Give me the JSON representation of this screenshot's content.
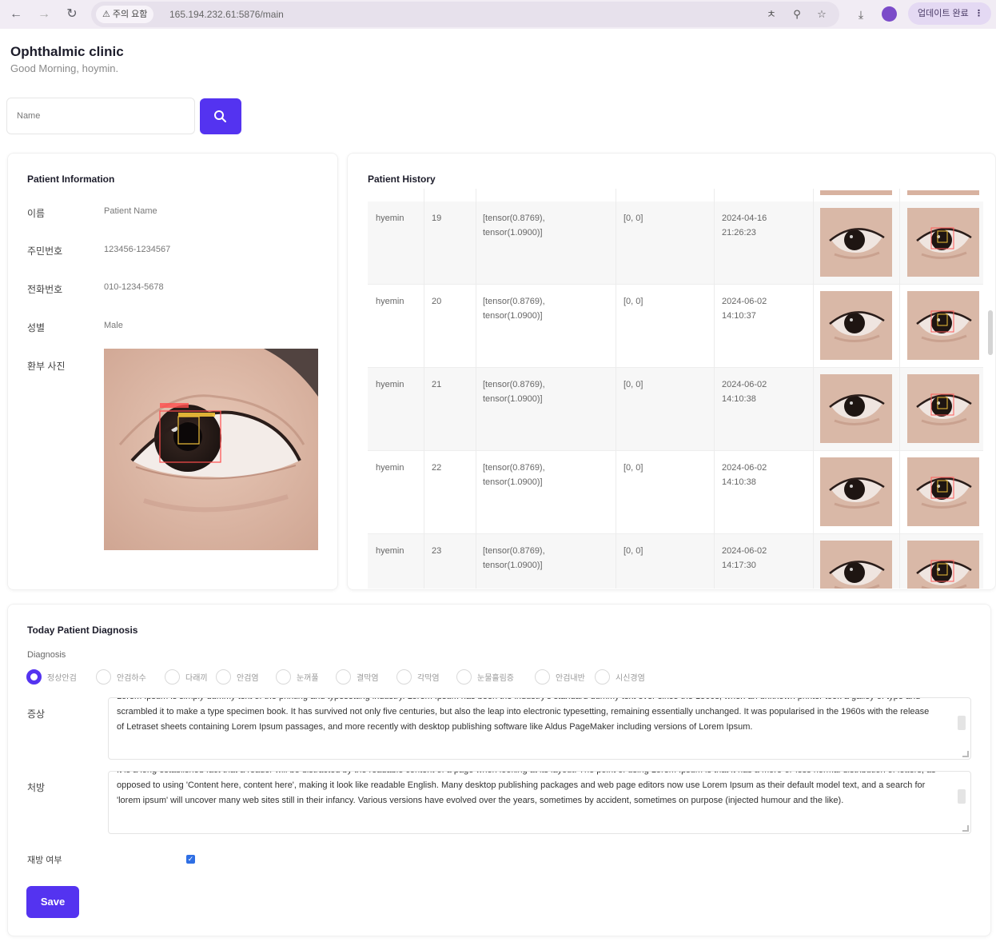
{
  "browser": {
    "security_label": "주의 요함",
    "url": "165.194.232.61:5876/main",
    "update_label": "업데이트 완료"
  },
  "header": {
    "title": "Ophthalmic clinic",
    "greeting": "Good Morning, hoymin."
  },
  "search": {
    "placeholder": "Name"
  },
  "patient_info": {
    "title": "Patient Information",
    "fields": [
      {
        "label": "이름",
        "value": "Patient Name"
      },
      {
        "label": "주민번호",
        "value": "123456-1234567"
      },
      {
        "label": "전화번호",
        "value": "010-1234-5678"
      },
      {
        "label": "성별",
        "value": "Male"
      },
      {
        "label": "환부 사진",
        "value": ""
      }
    ]
  },
  "history": {
    "title": "Patient History",
    "rows": [
      {
        "name": "hyemin",
        "id": "19",
        "tensor_line1": "[tensor(0.8769),",
        "tensor_line2": "tensor(1.0900)]",
        "pair": "[0, 0]",
        "date": "2024-04-16",
        "time": "21:26:23"
      },
      {
        "name": "hyemin",
        "id": "20",
        "tensor_line1": "[tensor(0.8769),",
        "tensor_line2": "tensor(1.0900)]",
        "pair": "[0, 0]",
        "date": "2024-06-02",
        "time": "14:10:37"
      },
      {
        "name": "hyemin",
        "id": "21",
        "tensor_line1": "[tensor(0.8769),",
        "tensor_line2": "tensor(1.0900)]",
        "pair": "[0, 0]",
        "date": "2024-06-02",
        "time": "14:10:38"
      },
      {
        "name": "hyemin",
        "id": "22",
        "tensor_line1": "[tensor(0.8769),",
        "tensor_line2": "tensor(1.0900)]",
        "pair": "[0, 0]",
        "date": "2024-06-02",
        "time": "14:10:38"
      },
      {
        "name": "hyemin",
        "id": "23",
        "tensor_line1": "[tensor(0.8769),",
        "tensor_line2": "tensor(1.0900)]",
        "pair": "[0, 0]",
        "date": "2024-06-02",
        "time": "14:17:30"
      }
    ]
  },
  "diagnosis": {
    "title": "Today Patient Diagnosis",
    "group_label": "Diagnosis",
    "options": [
      "정상안검",
      "안검하수",
      "다래끼",
      "안검염",
      "눈꺼풀",
      "결막염",
      "각막염",
      "눈물흘림증",
      "안검내반",
      "시신경염"
    ],
    "selected": "정상안검",
    "symptom_label": "증상",
    "symptom_text": "Lorem Ipsum is simply dummy text of the printing and typesetting industry. Lorem Ipsum has been the industry's standard dummy text ever since the 1500s, when an unknown printer took a galley of type and scrambled it to make a type specimen book. It has survived not only five centuries, but also the leap into electronic typesetting, remaining essentially unchanged. It was popularised in the 1960s with the release of Letraset sheets containing Lorem Ipsum passages, and more recently with desktop publishing software like Aldus PageMaker including versions of Lorem Ipsum.",
    "note_label": "처방",
    "note_text": "It is a long established fact that a reader will be distracted by the readable content of a page when looking at its layout. The point of using Lorem Ipsum is that it has a more-or-less normal distribution of letters, as opposed to using 'Content here, content here', making it look like readable English. Many desktop publishing packages and web page editors now use Lorem Ipsum as their default model text, and a search for 'lorem ipsum' will uncover many web sites still in their infancy. Various versions have evolved over the years, sometimes by accident, sometimes on purpose (injected humour and the like).",
    "consent_label": "재방 여부",
    "consent_checked": true,
    "save_label": "Save"
  },
  "colors": {
    "accent": "#5433f0",
    "checkbox": "#2f6fe4"
  }
}
